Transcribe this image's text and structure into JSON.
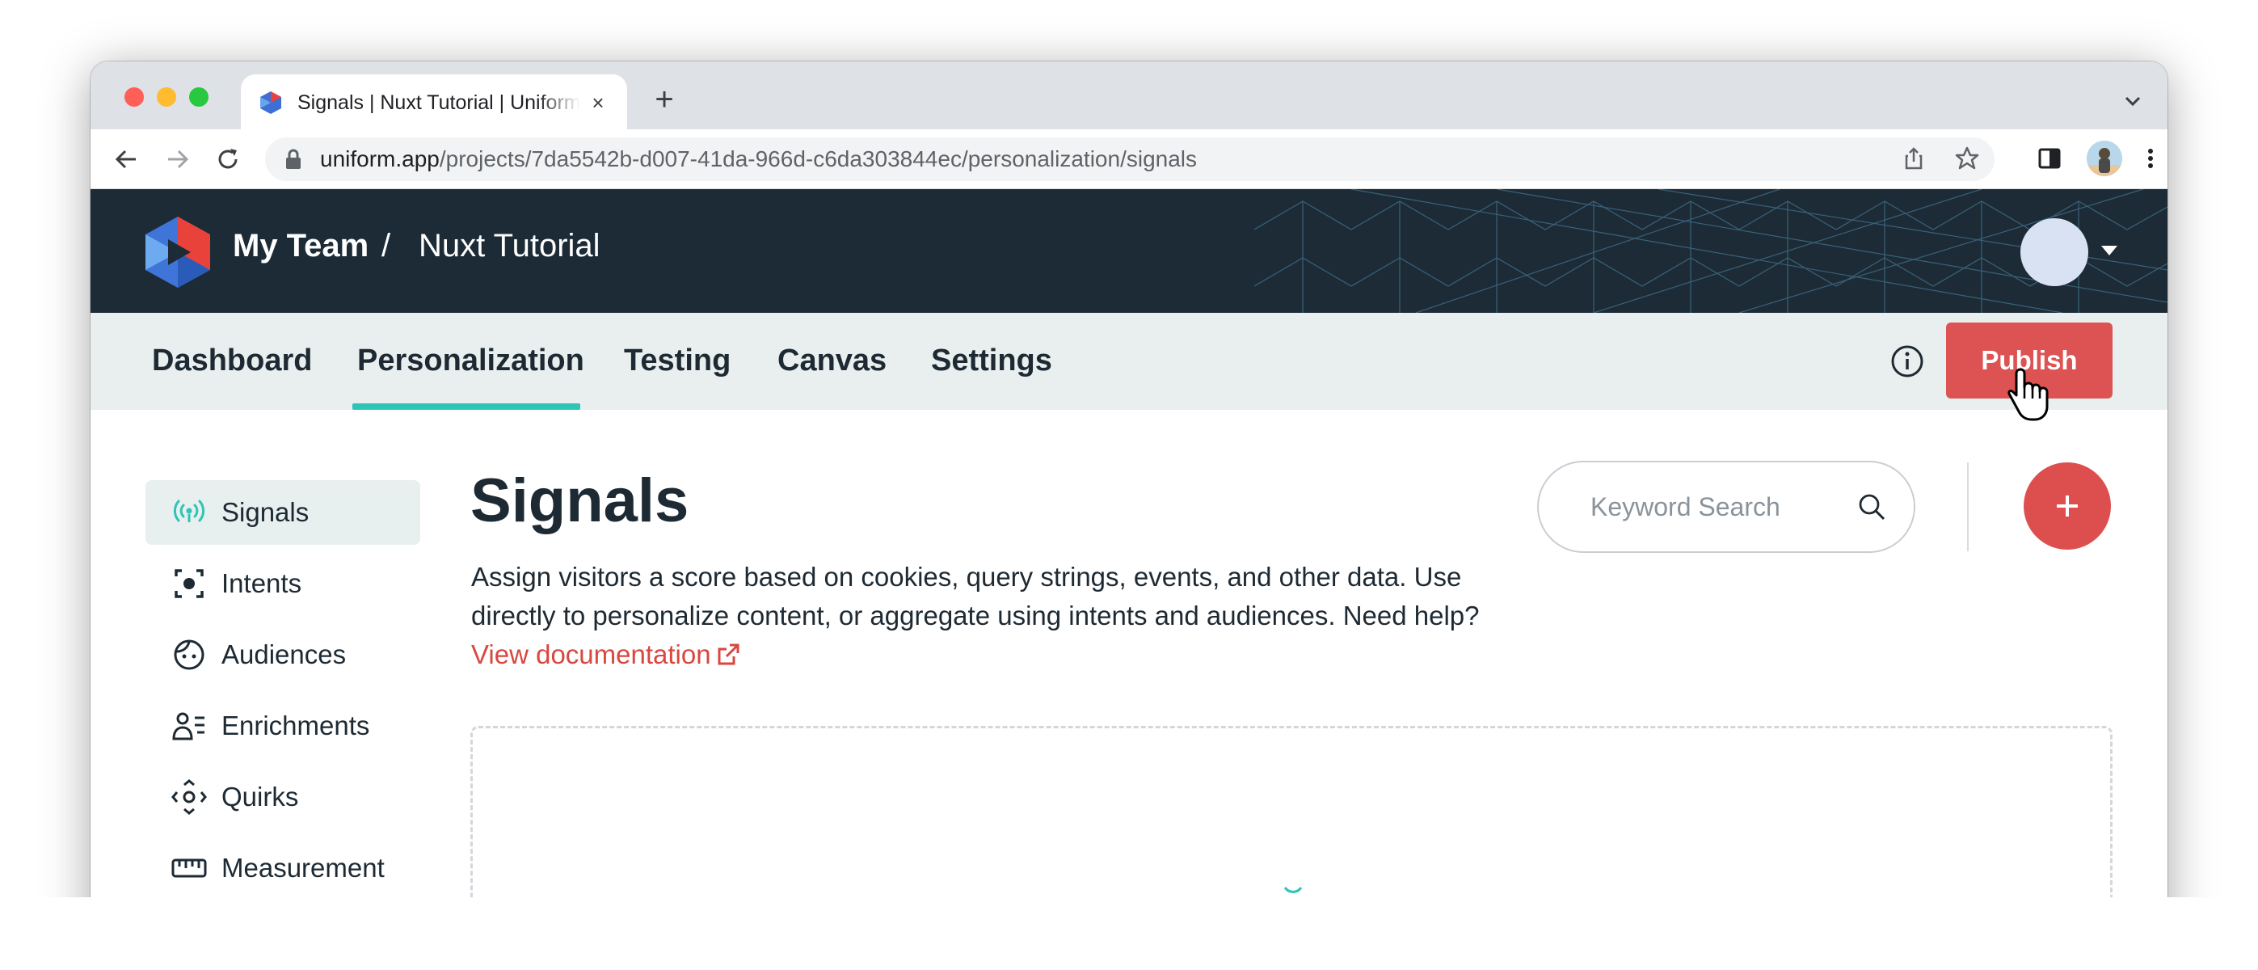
{
  "browser": {
    "tab_title": "Signals | Nuxt Tutorial | Uniform",
    "tab_close": "×",
    "new_tab": "+",
    "url_host": "uniform.app",
    "url_path": "/projects/7da5542b-d007-41da-966d-c6da303844ec/personalization/signals"
  },
  "header": {
    "team": "My Team",
    "separator": "/",
    "project": "Nuxt Tutorial"
  },
  "nav": {
    "items": [
      "Dashboard",
      "Personalization",
      "Testing",
      "Canvas",
      "Settings"
    ],
    "active": "Personalization",
    "publish_label": "Publish"
  },
  "sidebar": {
    "items": [
      {
        "label": "Signals",
        "icon": "signal-icon",
        "active": true
      },
      {
        "label": "Intents",
        "icon": "intent-icon",
        "active": false
      },
      {
        "label": "Audiences",
        "icon": "audience-icon",
        "active": false
      },
      {
        "label": "Enrichments",
        "icon": "enrichment-icon",
        "active": false
      },
      {
        "label": "Quirks",
        "icon": "quirk-icon",
        "active": false
      },
      {
        "label": "Measurement",
        "icon": "measurement-icon",
        "active": false
      }
    ]
  },
  "main": {
    "title": "Signals",
    "description": "Assign visitors a score based on cookies, query strings, events, and other data. Use directly to personalize content, or aggregate using intents and audiences. Need help?",
    "doc_link": "View documentation",
    "search_placeholder": "Keyword Search"
  },
  "colors": {
    "header_bg": "#1d2b36",
    "nav_bg": "#e9efef",
    "accent": "#2ec4b6",
    "publish": "#dd5252",
    "link": "#d9473f"
  }
}
